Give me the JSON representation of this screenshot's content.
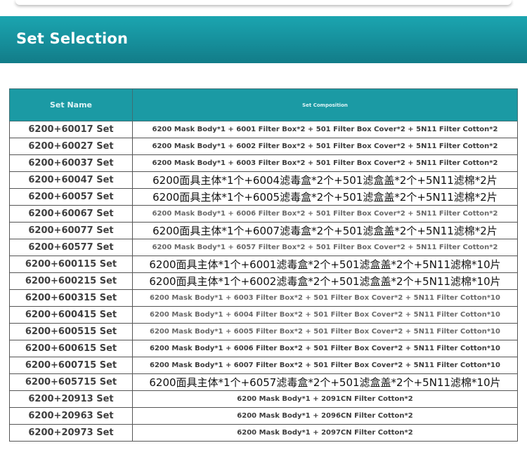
{
  "section": {
    "title": "Set Selection"
  },
  "table": {
    "headers": {
      "name": "Set Name",
      "composition": "Set Composition"
    },
    "rows": [
      {
        "name": "6200+60017 Set",
        "composition": "6200 Mask Body*1 + 6001 Filter Box*2 + 501 Filter Box Cover*2 + 5N11 Filter Cotton*2",
        "style": "en"
      },
      {
        "name": "6200+60027 Set",
        "composition": "6200 Mask Body*1 + 6002 Filter Box*2 + 501 Filter Box Cover*2 + 5N11 Filter Cotton*2",
        "style": "en"
      },
      {
        "name": "6200+60037 Set",
        "composition": "6200 Mask Body*1 + 6003 Filter Box*2 + 501 Filter Box Cover*2 + 5N11 Filter Cotton*2",
        "style": "en"
      },
      {
        "name": "6200+60047 Set",
        "composition": "6200面具主体*1个+6004滤毒盒*2个+501滤盒盖*2个+5N11滤棉*2片",
        "style": "cn"
      },
      {
        "name": "6200+60057 Set",
        "composition": "6200面具主体*1个+6005滤毒盒*2个+501滤盒盖*2个+5N11滤棉*2片",
        "style": "cn"
      },
      {
        "name": "6200+60067 Set",
        "composition": "6200 Mask Body*1 + 6006 Filter Box*2 + 501 Filter Box Cover*2 + 5N11 Filter Cotton*2",
        "style": "blur"
      },
      {
        "name": "6200+60077 Set",
        "composition": "6200面具主体*1个+6007滤毒盒*2个+501滤盒盖*2个+5N11滤棉*2片",
        "style": "cn"
      },
      {
        "name": "6200+60577 Set",
        "composition": "6200 Mask Body*1 + 6057 Filter Box*2 + 501 Filter Box Cover*2 + 5N11 Filter Cotton*2",
        "style": "blur"
      },
      {
        "name": "6200+600115 Set",
        "composition": "6200面具主体*1个+6001滤毒盒*2个+501滤盒盖*2个+5N11滤棉*10片",
        "style": "cn"
      },
      {
        "name": "6200+600215 Set",
        "composition": "6200面具主体*1个+6002滤毒盒*2个+501滤盒盖*2个+5N11滤棉*10片",
        "style": "cn"
      },
      {
        "name": "6200+600315 Set",
        "composition": "6200 Mask Body*1 + 6003 Filter Box*2 + 501 Filter Box Cover*2 + 5N11 Filter Cotton*10",
        "style": "blur"
      },
      {
        "name": "6200+600415 Set",
        "composition": "6200 Mask Body*1 + 6004 Filter Box*2 + 501 Filter Box Cover*2 + 5N11 Filter Cotton*10",
        "style": "blur"
      },
      {
        "name": "6200+600515 Set",
        "composition": "6200 Mask Body*1 + 6005 Filter Box*2 + 501 Filter Box Cover*2 + 5N11 Filter Cotton*10",
        "style": "blur"
      },
      {
        "name": "6200+600615 Set",
        "composition": "6200 Mask Body*1 + 6006 Filter Box*2 + 501 Filter Box Cover*2 + 5N11 Filter Cotton*10",
        "style": "en"
      },
      {
        "name": "6200+600715 Set",
        "composition": "6200 Mask Body*1 + 6007 Filter Box*2 + 501 Filter Box Cover*2 + 5N11 Filter Cotton*10",
        "style": "en"
      },
      {
        "name": "6200+605715 Set",
        "composition": "6200面具主体*1个+6057滤毒盒*2个+501滤盒盖*2个+5N11滤棉*10片",
        "style": "cn"
      },
      {
        "name": "6200+20913 Set",
        "composition": "6200 Mask Body*1 + 2091CN Filter Cotton*2",
        "style": "en"
      },
      {
        "name": "6200+20963 Set",
        "composition": "6200 Mask Body*1 + 2096CN Filter Cotton*2",
        "style": "en"
      },
      {
        "name": "6200+20973 Set",
        "composition": "6200 Mask Body*1 + 2097CN Filter Cotton*2",
        "style": "en"
      }
    ]
  },
  "colors": {
    "banner": "#168f9b",
    "header": "#1b9aa4",
    "border": "#555555"
  }
}
